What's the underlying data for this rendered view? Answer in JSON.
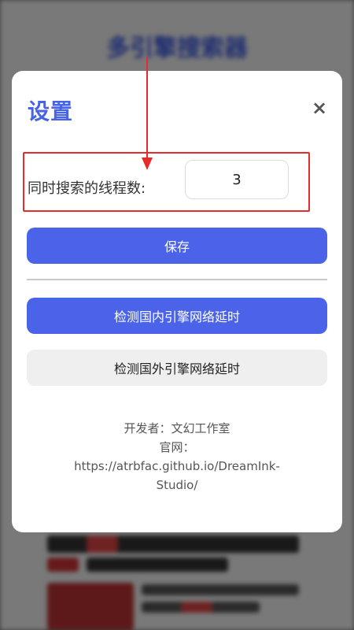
{
  "background": {
    "app_title": "多引擎搜索器"
  },
  "settings_modal": {
    "title": "设置",
    "close_symbol": "×",
    "thread_count": {
      "label": "同时搜索的线程数:",
      "value": "3"
    },
    "save_label": "保存",
    "test_domestic_label": "检测国内引擎网络延时",
    "test_foreign_label": "检测国外引擎网络延时",
    "footer": {
      "developer": "开发者：文幻工作室",
      "website": "官网：https://atrbfac.github.io/DreamInk-Studio/"
    }
  },
  "colors": {
    "accent": "#4a63e8",
    "title": "#4763e6",
    "annotation": "#e52b2b"
  }
}
